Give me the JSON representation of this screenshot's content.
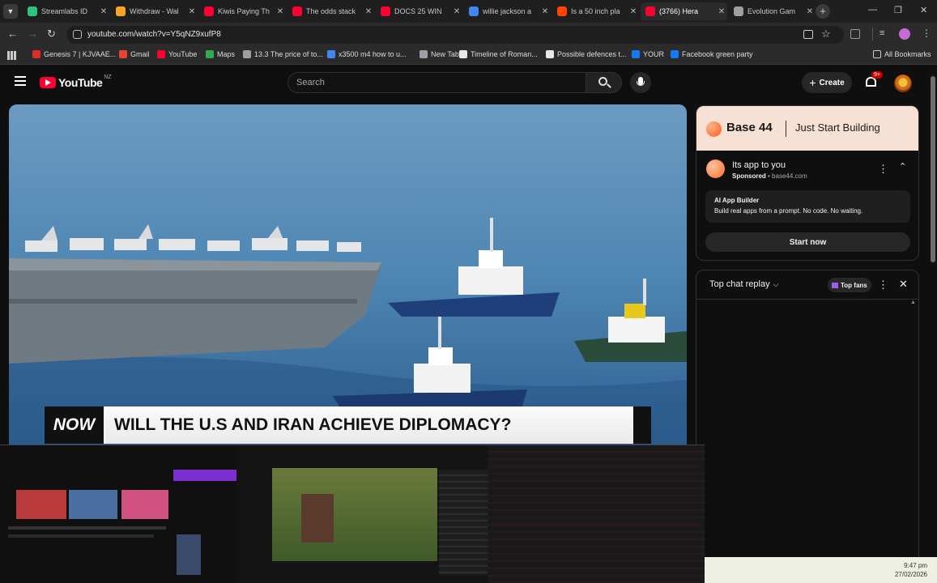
{
  "browser": {
    "tabs": [
      {
        "title": "Streamlabs ID",
        "color": "#2ec27e"
      },
      {
        "title": "Withdraw - Wal",
        "color": "#f5a623"
      },
      {
        "title": "Kiwis Paying Th",
        "color": "#ff0033"
      },
      {
        "title": "The odds stack",
        "color": "#ff0033"
      },
      {
        "title": "DOCS 25 WIN",
        "color": "#ff0033"
      },
      {
        "title": "willie jackson a",
        "color": "#4285f4"
      },
      {
        "title": "Is a 50 inch pla",
        "color": "#ff4500"
      },
      {
        "title": "(3766) Hera",
        "color": "#ff0033"
      },
      {
        "title": "Evolution Gam",
        "color": "#9aa0a6"
      }
    ],
    "url": "youtube.com/watch?v=Y5qNZ9xufP8",
    "bookmarks": [
      {
        "label": "Genesis 7 | KJVAAE...",
        "color": "#d93025"
      },
      {
        "label": "Gmail",
        "color": "#ea4335"
      },
      {
        "label": "YouTube",
        "color": "#ff0033"
      },
      {
        "label": "Maps",
        "color": "#34a853"
      },
      {
        "label": "13.3 The price of to...",
        "color": "#9aa0a6"
      },
      {
        "label": "x3500 m4 how to u...",
        "color": "#4285f4"
      },
      {
        "label": "New Tab",
        "color": "#9aa0a6"
      },
      {
        "label": "Timeline of Roman...",
        "color": "#e8e8e8"
      },
      {
        "label": "Possible defences t...",
        "color": "#e8e8e8"
      },
      {
        "label": "YOUR",
        "color": "#1877f2"
      },
      {
        "label": "Facebook green party",
        "color": "#1877f2"
      }
    ],
    "all_bookmarks": "All Bookmarks"
  },
  "youtube": {
    "logo": "YouTube",
    "region": "NZ",
    "search_placeholder": "Search",
    "create_label": "Create",
    "notif_count": "9+"
  },
  "video": {
    "banner_tag": "NOW",
    "banner_text": "WILL THE U.S AND IRAN ACHIEVE DIPLOMACY?"
  },
  "ad": {
    "brand": "Base 44",
    "tagline": "Just Start Building",
    "title": "Its app to you",
    "sponsored": "Sponsored",
    "domain": "base44.com",
    "inner_title": "AI App Builder",
    "inner_desc": "Build real apps from a prompt. No code. No waiting.",
    "cta": "Start now"
  },
  "chat": {
    "title": "Top chat replay",
    "top_fans": "Top fans"
  },
  "taskbar": {
    "time": "9:47 pm",
    "date": "27/02/2026"
  }
}
